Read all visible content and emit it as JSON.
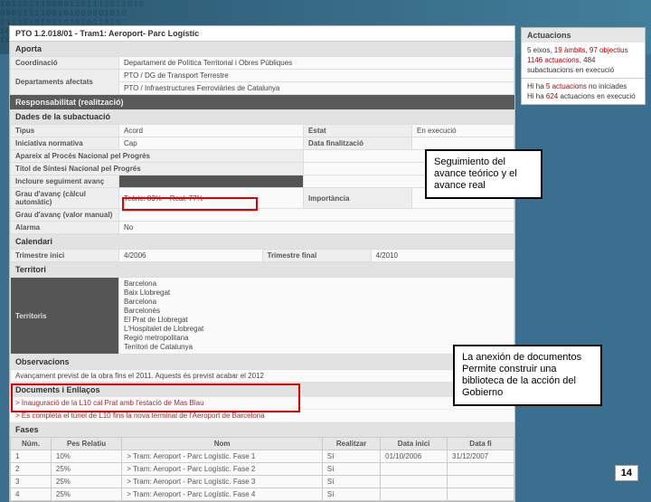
{
  "header": {
    "title": "PTO 1.2.018/01 - Tram1: Aeroport- Parc Logístic"
  },
  "aporta": {
    "section": "Aporta",
    "coord_label": "Coordinació",
    "coord_value": "Departament de Política Territorial i Obres Públiques",
    "dept_label": "Departaments afectats",
    "dept_value1": "PTO / DG de Transport Terrestre",
    "dept_value2": "PTO / Infraestructures Ferroviàries de Catalunya"
  },
  "resp": {
    "section": "Responsabilitat (realització)"
  },
  "dades": {
    "section": "Dades de la subactuació",
    "tipus_l": "Tipus",
    "tipus_v": "Acord",
    "estat_l": "Estat",
    "estat_v": "En execució",
    "inic_l": "Iniciativa normativa",
    "inic_v": "Cap",
    "datafin_l": "Data finalització",
    "datafin_v": "",
    "aparPN_l": "Apareix al Procés Nacional pel Progrés",
    "aparPN_v": "",
    "titolPN_l": "Títol de Síntesi Nacional pel Progrés",
    "titolPN_v": "",
    "incloure_l": "Incloure seguiment avanç",
    "incloure_v": "",
    "grauA_l": "Grau d'avanç (càlcul automàtic)",
    "grauA_teoric_l": "Teòric:",
    "grauA_teoric_v": "83%",
    "grauA_real_l": "Real:",
    "grauA_real_v": "77%",
    "import_l": "Importància",
    "import_v": "",
    "grauM_l": "Grau d'avanç (valor manual)",
    "grauM_v": "",
    "alarma_l": "Alarma",
    "alarma_v": "No"
  },
  "calendari": {
    "section": "Calendari",
    "tini_l": "Trimestre inici",
    "tini_v": "4/2006",
    "tfin_l": "Trimestre final",
    "tfin_v": "4/2010"
  },
  "territori": {
    "section": "Territori",
    "label": "Territoris",
    "items": [
      "Barcelona",
      "Baix Llobregat",
      "Barcelona",
      "Barcelonès",
      "El Prat de Llobregat",
      "L'Hospitalet de Llobregat",
      "Regió metropolitana",
      "Territori de Catalunya"
    ]
  },
  "observ": {
    "section": "Observacions",
    "text": "Avançament previst de la obra fins el 2011. Aquests és previst acabar el 2012"
  },
  "docs": {
    "section": "Documents i Enllaços",
    "d1": "> Inauguració de la L10 cal Prat amb l'estació de Mas Blau",
    "d2": "> Es completa el túnel de L10 fins la nova terminal de l'Aeroport de Barcelona"
  },
  "phases": {
    "section": "Fases",
    "headers": {
      "num": "Núm.",
      "pes": "Pes Relatiu",
      "nom": "Nom",
      "realit": "Realitzar",
      "dini": "Data inici",
      "dfi": "Data fi"
    },
    "rows": [
      {
        "num": "1",
        "pes": "10%",
        "nom": "> Tram: Aeroport - Parc Logístic. Fase 1",
        "realit": "Sí",
        "dini": "01/10/2006",
        "dfi": "31/12/2007"
      },
      {
        "num": "2",
        "pes": "25%",
        "nom": "> Tram: Aeroport - Parc Logístic. Fase 2",
        "realit": "Sí",
        "dini": "",
        "dfi": ""
      },
      {
        "num": "3",
        "pes": "25%",
        "nom": "> Tram: Aeroport - Parc Logístic. Fase 3",
        "realit": "Sí",
        "dini": "",
        "dfi": ""
      },
      {
        "num": "4",
        "pes": "25%",
        "nom": "> Tram: Aeroport - Parc Logístic. Fase 4",
        "realit": "Sí",
        "dini": "",
        "dfi": ""
      }
    ]
  },
  "side": {
    "title": "Actuacions",
    "l1a": "5 eixos, ",
    "l1b": "19 àmbits, 97 objectius",
    "l2a": "1146 actuacions, ",
    "l2b": "484 subactuacions en execució",
    "l3a": "Hi ha ",
    "l3b": "5 actuacions",
    "l3c": " no iniciades",
    "l4a": "Hi ha ",
    "l4b": "624",
    "l4c": " actuacions en execució"
  },
  "callouts": {
    "c1": "Seguimiento del avance teórico y el avance real",
    "c2": "La anexión de documentos Permite construir una biblioteca de la acción del Gobierno"
  },
  "pagenum": "14",
  "bg": "1011011100001101111011010\n0001111100101000001010\n011101010110101011010\n10101001010101001\n1011010"
}
